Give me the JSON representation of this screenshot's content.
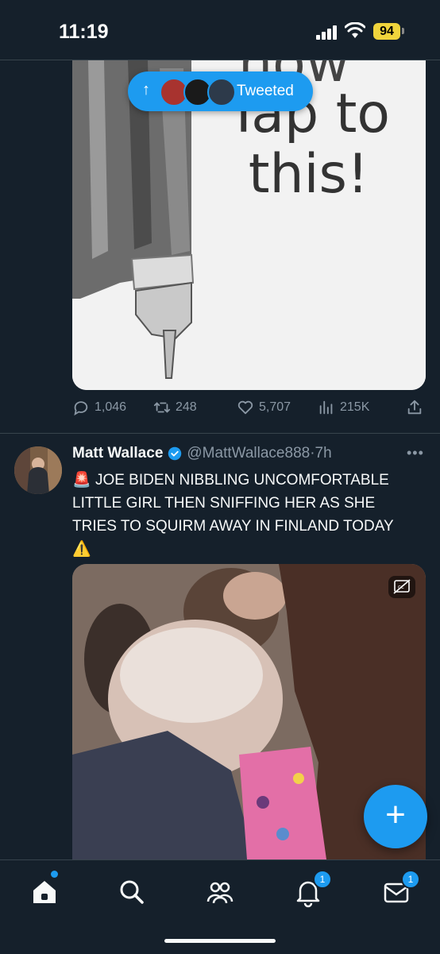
{
  "status_bar": {
    "time": "11:19",
    "battery": "94"
  },
  "pill": {
    "label": "Tweeted"
  },
  "tweet1": {
    "media_text_partial": "now",
    "media_text": "Tap to\nthis!",
    "actions": {
      "replies": "1,046",
      "retweets": "248",
      "likes": "5,707",
      "views": "215K"
    }
  },
  "tweet2": {
    "author": "Matt Wallace",
    "handle": "@MattWallace888",
    "dot": "·",
    "time": "7h",
    "more": "•••",
    "text_line1": "JOE BIDEN NIBBLING UNCOMFORTABLE LITTLE GIRL THEN SNIFFING HER AS SHE TRIES TO SQUIRM AWAY IN FINLAND TODAY",
    "emoji_siren": "🚨",
    "emoji_warning": "⚠️"
  },
  "fab": {
    "label": "+"
  },
  "tab_bar": {
    "notifications_badge": "1",
    "messages_badge": "1"
  },
  "colors": {
    "background": "#15202b",
    "accent": "#1d9bf0",
    "muted": "#8b98a5"
  }
}
